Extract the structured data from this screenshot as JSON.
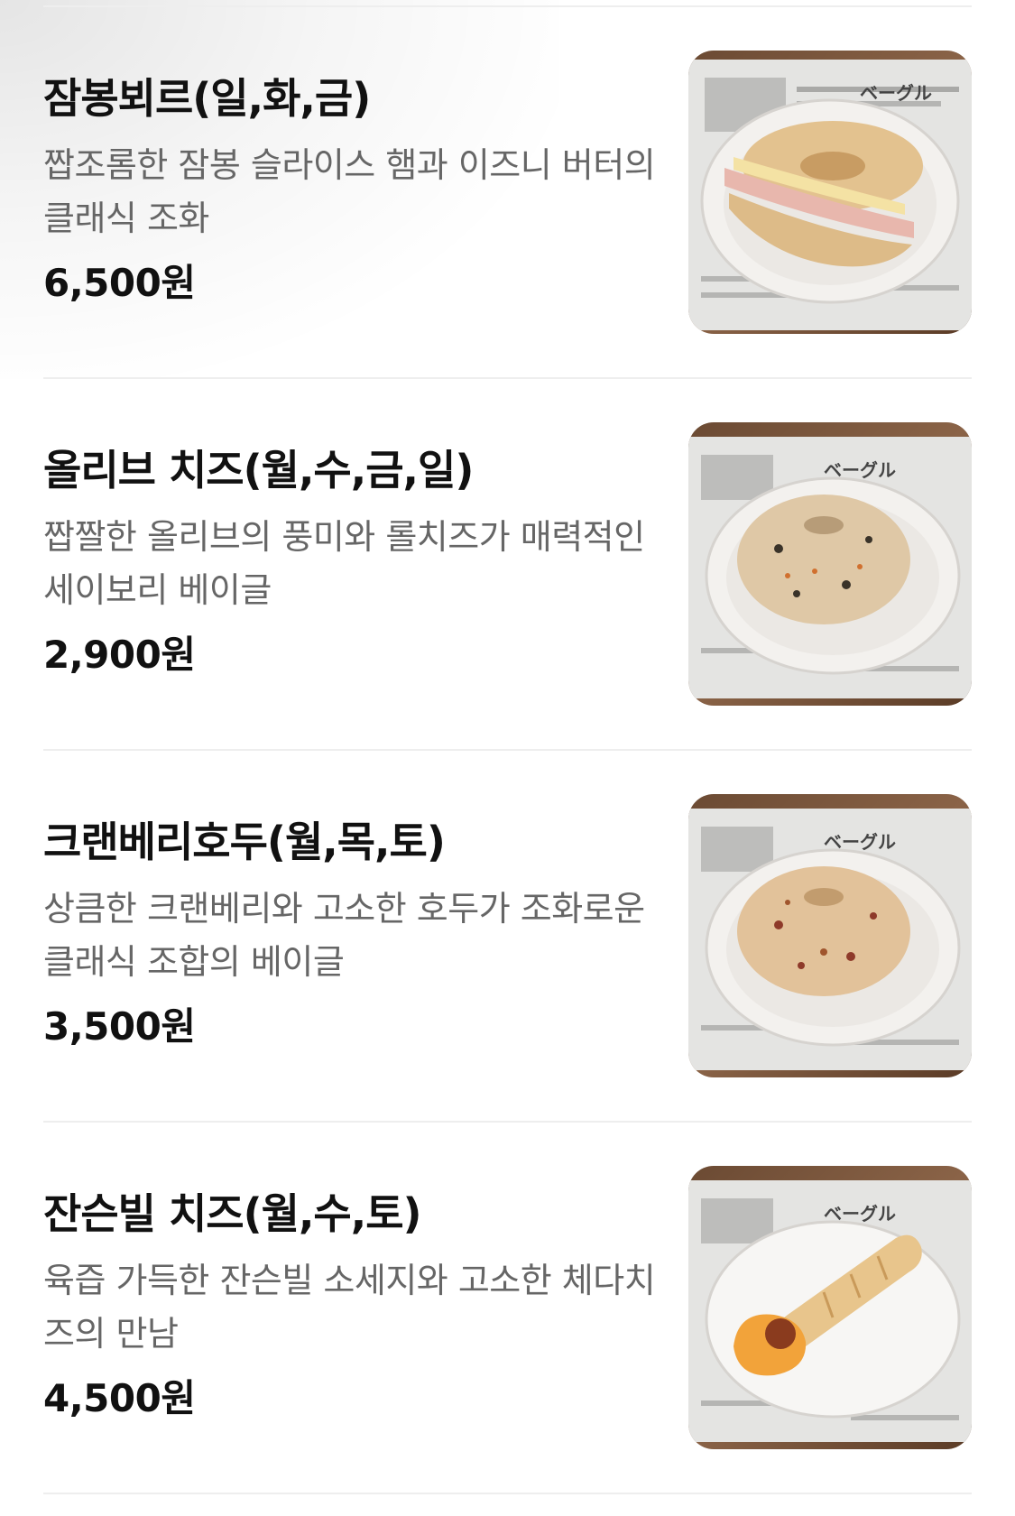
{
  "menu": {
    "items": [
      {
        "name": "잠봉뵈르(일,화,금)",
        "description": "짭조롬한 잠봉 슬라이스 햄과 이즈니 버터의 클래식 조화",
        "price": "6,500원",
        "image": "jambon-beurre-bagel-photo",
        "newspaper_heading": "ベーグル"
      },
      {
        "name": "올리브 치즈(월,수,금,일)",
        "description": "짭짤한 올리브의 풍미와 롤치즈가 매력적인 세이보리 베이글",
        "price": "2,900원",
        "image": "olive-cheese-bagel-photo",
        "newspaper_heading": "ベーグル"
      },
      {
        "name": "크랜베리호두(월,목,토)",
        "description": "상큼한 크랜베리와 고소한 호두가 조화로운 클래식 조합의 베이글",
        "price": "3,500원",
        "image": "cranberry-walnut-bagel-photo",
        "newspaper_heading": "ベーグル"
      },
      {
        "name": "잔슨빌 치즈(월,수,토)",
        "description": "육즙 가득한 잔슨빌 소세지와 고소한 체다치즈의 만남",
        "price": "4,500원",
        "image": "johnsonville-cheese-sausage-bread-photo",
        "newspaper_heading": "ベーグル"
      }
    ]
  },
  "colors": {
    "text_primary": "#111111",
    "text_secondary": "#666666",
    "divider": "#eeeeee"
  }
}
